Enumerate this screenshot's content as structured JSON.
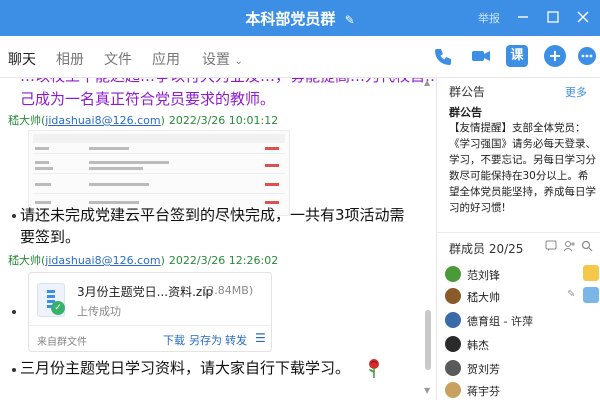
{
  "window": {
    "title": "本科部党员群",
    "report": "举报",
    "edit_icon": "✎"
  },
  "tabs": [
    {
      "label": "聊天"
    },
    {
      "label": "相册"
    },
    {
      "label": "文件"
    },
    {
      "label": "应用"
    },
    {
      "label": "设置"
    }
  ],
  "toolbar": {
    "course_label": "课",
    "plus_label": "+"
  },
  "colors": {
    "accent": "#3d8fe6",
    "purple_text": "#8e1ccf",
    "sender_green": "#2a8a3a"
  },
  "chat": {
    "top_partial_line": "…以校工干能达起…争以付大为业及…，毋能提高…为代校自…",
    "purple_line": "己成为一名真正符合党员要求的教师。",
    "messages": [
      {
        "sender": "嵇大帅",
        "email": "jidashuai8@126.com",
        "time": "2022/3/26 10:01:12"
      },
      {
        "sender": "嵇大帅",
        "email": "jidashuai8@126.com",
        "time": "2022/3/26 12:26:02"
      }
    ],
    "text_reminder_1": "请还未完成党建云平台签到的尽快完成，一共有3项活动需",
    "text_reminder_2": "要签到。",
    "file": {
      "name": "3月份主题党日...资料.zip",
      "size": "(3.84MB)",
      "status": "上传成功",
      "source": "来自群文件",
      "actions": [
        "下载",
        "另存为",
        "转发"
      ]
    },
    "text_download": "三月份主题党日学习资料，请大家自行下载学习。"
  },
  "announcement": {
    "section_title": "群公告",
    "more": "更多",
    "title": "群公告",
    "body": "【友情提醒】支部全体党员：《学习强国》请务必每天登录、学习，不要忘记。另每日学习分数尽可能保持在30分以上。希望全体党员能坚持，养成每日学习的好习惯!"
  },
  "members": {
    "section_title": "群成员 20/25",
    "list": [
      {
        "name": "范刘锋"
      },
      {
        "name": "嵇大帅"
      },
      {
        "name": "德育组 - 许萍"
      },
      {
        "name": "韩杰"
      },
      {
        "name": "贺刘芳"
      },
      {
        "name": "蒋宇芬"
      }
    ]
  }
}
